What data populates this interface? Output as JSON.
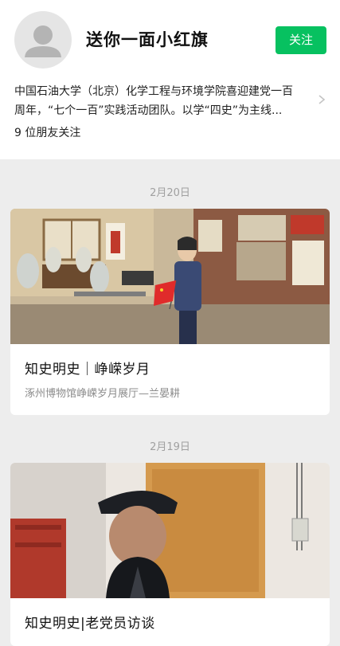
{
  "account": {
    "name": "送你一面小红旗",
    "follow_label": "关注",
    "description_lines": [
      "中国石油大学（北京）化学工程与环境学院喜迎建党一百",
      "周年，“七个一百”实践活动团队。以学“四史”为主线..."
    ],
    "friends_following": "9 位朋友关注"
  },
  "posts": [
    {
      "date": "2月20日",
      "title": "知史明史｜峥嵘岁月",
      "subtitle": "涿州博物馆峥嵘岁月展厅—兰晏耕",
      "image_icon": "museum-video-thumbnail"
    },
    {
      "date": "2月19日",
      "title": "知史明史|老党员访谈",
      "image_icon": "elder-interview-thumbnail"
    }
  ],
  "colors": {
    "accent": "#07c160",
    "background": "#ededed",
    "card": "#ffffff",
    "secondary_text": "#8c8c8c"
  }
}
